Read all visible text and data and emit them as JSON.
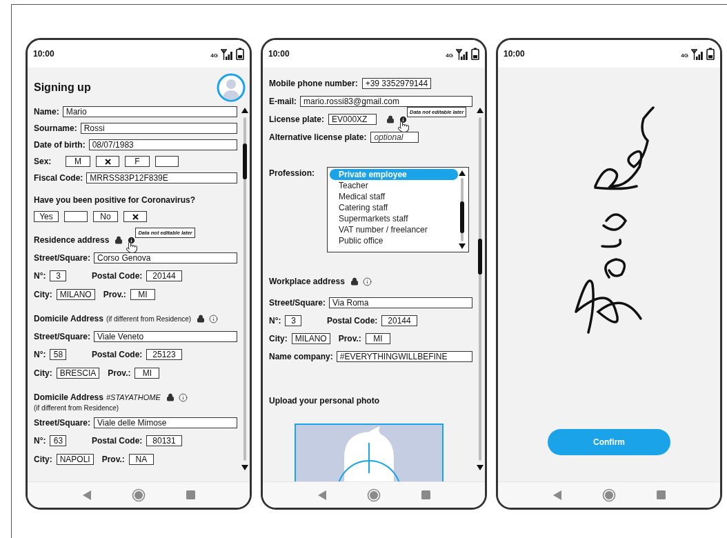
{
  "screens": [
    {
      "kind": "form",
      "time": "10:00",
      "network": "4G",
      "title": "Signing up",
      "rows": [
        {
          "kind": "field",
          "label": "Name:",
          "value": "Mario"
        },
        {
          "kind": "field",
          "label": "Sourname:",
          "value": "Rossi"
        },
        {
          "kind": "field",
          "label": "Date of birth:",
          "value": "08/07/1983"
        },
        {
          "kind": "choice",
          "label": "Sex:",
          "options": [
            {
              "label": "M",
              "checked": true
            },
            {
              "label": "F",
              "checked": false
            }
          ]
        },
        {
          "kind": "field",
          "label": "Fiscal Code:",
          "value": "MRRSS83P12F839E"
        },
        {
          "kind": "question",
          "text": "Have you been positive for Coronavirus?"
        },
        {
          "kind": "choice",
          "options": [
            {
              "label": "Yes",
              "checked": false
            },
            {
              "label": "No",
              "checked": true
            }
          ]
        },
        {
          "kind": "section",
          "title": "Residence address",
          "locked": true,
          "tooltip": "Data not editable later"
        },
        {
          "kind": "field",
          "label": "Street/Square:",
          "value": "Corso Genova"
        },
        {
          "kind": "pair",
          "fields": [
            {
              "label": "N°:",
              "value": "3"
            },
            {
              "label": "Postal Code:",
              "value": "20144"
            }
          ]
        },
        {
          "kind": "pair",
          "fields": [
            {
              "label": "City:",
              "value": "MILANO"
            },
            {
              "label": "Prov.:",
              "value": "MI"
            }
          ]
        },
        {
          "kind": "section",
          "title": "Domicile Address",
          "note": "(if different from Residence)",
          "locked": true
        },
        {
          "kind": "field",
          "label": "Street/Square:",
          "value": "Viale Veneto"
        },
        {
          "kind": "pair",
          "fields": [
            {
              "label": "N°:",
              "value": "58"
            },
            {
              "label": "Postal Code:",
              "value": "25123"
            }
          ]
        },
        {
          "kind": "pair",
          "fields": [
            {
              "label": "City:",
              "value": "BRESCIA"
            },
            {
              "label": "Prov.:",
              "value": "MI"
            }
          ]
        },
        {
          "kind": "section",
          "title": "Domicile Address",
          "tag": "#STAYATHOME",
          "note_below": "(if different from Residence)",
          "locked": true
        },
        {
          "kind": "field",
          "label": "Street/Square:",
          "value": "Viale delle Mimose"
        },
        {
          "kind": "pair",
          "fields": [
            {
              "label": "N°:",
              "value": "63"
            },
            {
              "label": "Postal Code:",
              "value": "80131"
            }
          ]
        },
        {
          "kind": "pair",
          "fields": [
            {
              "label": "City:",
              "value": "NAPOLI"
            },
            {
              "label": "Prov.:",
              "value": "NA"
            }
          ]
        }
      ]
    },
    {
      "kind": "form",
      "time": "10:00",
      "network": "4G",
      "rows": [
        {
          "kind": "short_field",
          "label": "Mobile phone number:",
          "value": "+39 3352979144"
        },
        {
          "kind": "field",
          "label": "E-mail:",
          "value": "mario.rossi83@gmail.com"
        },
        {
          "kind": "short_field",
          "label": "License plate:",
          "value": "EV000XZ",
          "locked": true,
          "tooltip": "Data not editable later"
        },
        {
          "kind": "short_field",
          "label": "Alternative license plate:",
          "placeholder": "optional"
        },
        {
          "kind": "list",
          "label": "Profession:",
          "items": [
            {
              "label": "Private employee",
              "selected": true
            },
            {
              "label": "Teacher",
              "selected": false
            },
            {
              "label": "Medical staff",
              "selected": false
            },
            {
              "label": "Catering staff",
              "selected": false
            },
            {
              "label": "Supermarkets staff",
              "selected": false
            },
            {
              "label": "VAT number / freelancer",
              "selected": false
            },
            {
              "label": "Public office",
              "selected": false
            }
          ]
        },
        {
          "kind": "section",
          "title": "Workplace address",
          "locked": true
        },
        {
          "kind": "field",
          "label": "Street/Square:",
          "value": "Via Roma"
        },
        {
          "kind": "pair",
          "fields": [
            {
              "label": "N°:",
              "value": "3"
            },
            {
              "label": "Postal Code:",
              "value": "20144"
            }
          ]
        },
        {
          "kind": "pair",
          "fields": [
            {
              "label": "City:",
              "value": "MILANO"
            },
            {
              "label": "Prov.:",
              "value": "MI"
            }
          ]
        },
        {
          "kind": "field",
          "label": "Name company:",
          "value": "#EVERYTHINGWILLBEFINE"
        },
        {
          "kind": "heading",
          "text": "Upload your personal photo"
        },
        {
          "kind": "photo"
        }
      ]
    },
    {
      "kind": "signature",
      "time": "10:00",
      "network": "4G",
      "button": "Confirm"
    }
  ]
}
